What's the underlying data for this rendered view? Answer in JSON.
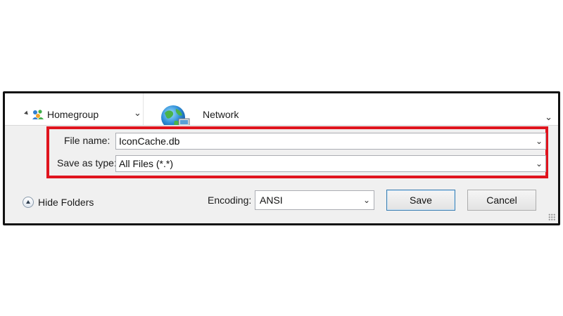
{
  "nav": {
    "homegroup_label": "Homegroup",
    "network_label": "Network",
    "nav_chevron": "⌄",
    "file_chevron": "⌄"
  },
  "fields": {
    "file_name_label": "File name:",
    "file_name_value": "IconCache.db",
    "save_type_label": "Save as type:",
    "save_type_value": "All Files  (*.*)",
    "chevron": "⌄"
  },
  "bottom": {
    "hide_folders_label": "Hide Folders",
    "encoding_label": "Encoding:",
    "encoding_value": "ANSI",
    "encoding_chevron": "⌄",
    "save_label": "Save",
    "cancel_label": "Cancel"
  },
  "colors": {
    "highlight": "#e0141e",
    "dialog_bg": "#f0f0f0",
    "frame": "#111111"
  },
  "icons": {
    "homegroup": "homegroup-icon",
    "network": "network-globe-icon",
    "hide_folders": "chevron-up-circle-icon",
    "expand": "expand-arrow-icon"
  }
}
